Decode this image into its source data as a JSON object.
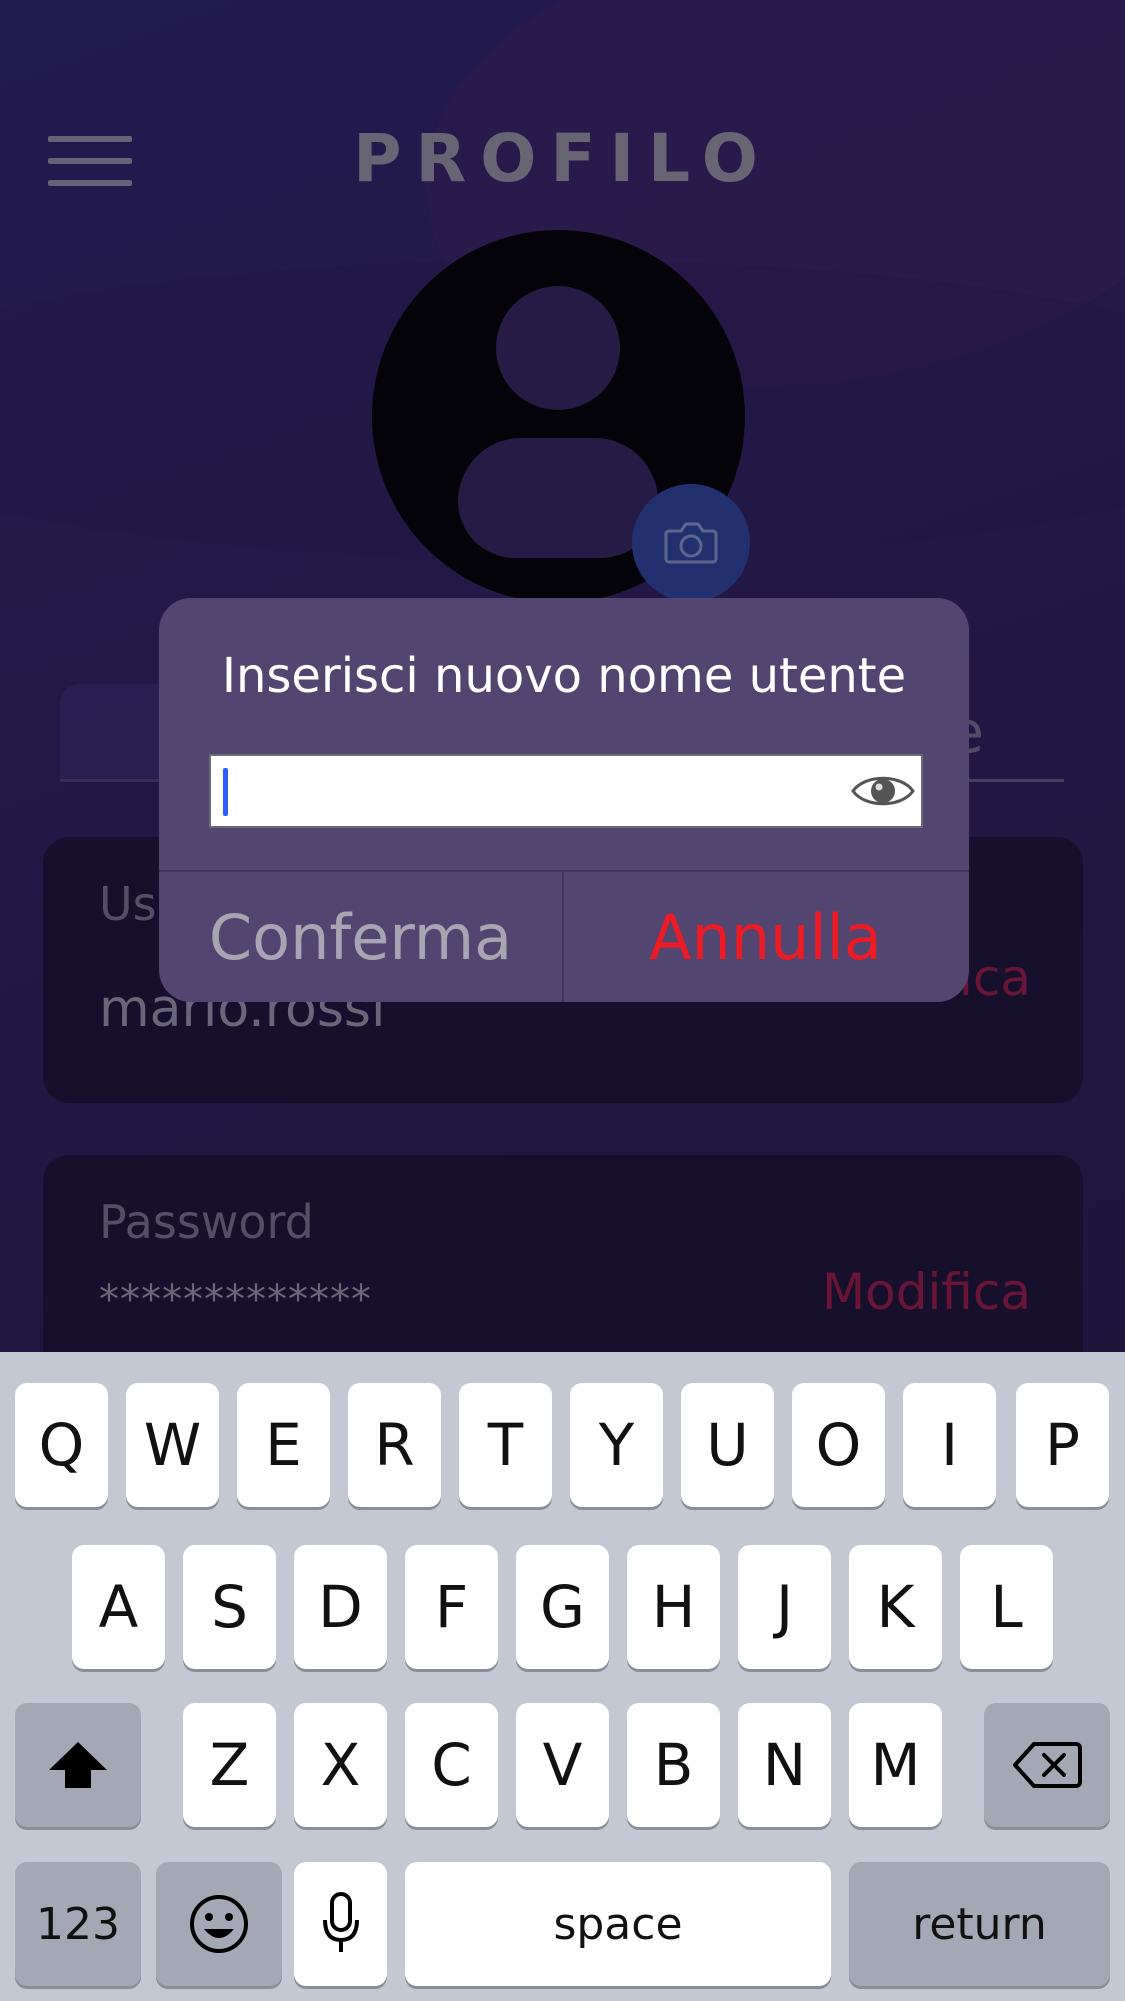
{
  "header": {
    "title": "PROFILO"
  },
  "tabs": {
    "right_label_fragment": "e"
  },
  "cards": {
    "username": {
      "label": "Us",
      "value": "mario.rossi",
      "action": "ica"
    },
    "password": {
      "label": "Password",
      "value": "*************",
      "action": "Modifica"
    }
  },
  "dialog": {
    "title": "Inserisci nuovo nome utente",
    "input_value": "",
    "confirm_label": "Conferma",
    "cancel_label": "Annulla"
  },
  "keyboard": {
    "row1": [
      "Q",
      "W",
      "E",
      "R",
      "T",
      "Y",
      "U",
      "O",
      "I",
      "P"
    ],
    "row2": [
      "A",
      "S",
      "D",
      "F",
      "G",
      "H",
      "J",
      "K",
      "L"
    ],
    "row3": [
      "Z",
      "X",
      "C",
      "V",
      "B",
      "N",
      "M"
    ],
    "numbers_label": "123",
    "space_label": "space",
    "return_label": "return"
  },
  "colors": {
    "accent_cancel": "#ee1b24",
    "accent_edit": "#8b1940",
    "caret": "#2d5cff",
    "camera_button": "#2a3f8c"
  }
}
